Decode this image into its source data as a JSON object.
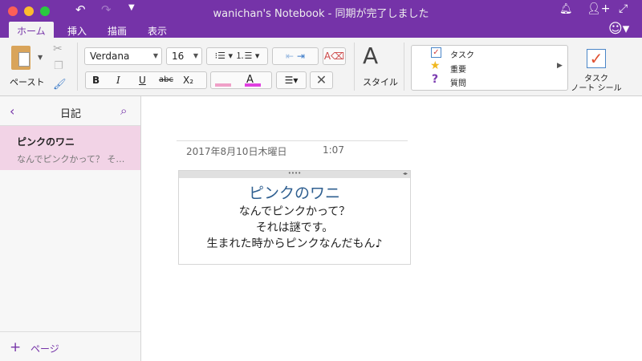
{
  "window": {
    "title": "wanichan's Notebook - 同期が完了しました"
  },
  "tabs": [
    "ホーム",
    "挿入",
    "描画",
    "表示"
  ],
  "ribbon": {
    "paste": "ペースト",
    "font": "Verdana",
    "size": "16",
    "bold": "B",
    "italic": "I",
    "underline": "U",
    "strike": "abc",
    "subscript": "X₂",
    "font_color": "A",
    "style": "スタイル",
    "tags": [
      {
        "label": "タスク",
        "icon": "checkbox-icon"
      },
      {
        "label": "重要",
        "icon": "star-icon"
      },
      {
        "label": "質問",
        "icon": "question-icon"
      }
    ],
    "task_note_tag": [
      "タスク",
      "ノート シール"
    ]
  },
  "colors": {
    "accent": "#7533a8",
    "highlight": "#f0a0c8",
    "font_color": "#e040e0",
    "selected_page": "#f2d3e6"
  },
  "sidebar": {
    "section": "日記",
    "pages": [
      {
        "title": "ピンクのワニ",
        "preview": "なんでピンクかって？ そ…"
      }
    ],
    "add_page": "ページ"
  },
  "page": {
    "date": "2017年8月10日木曜日",
    "time": "1:07",
    "lines": [
      "ピンクのワニ",
      "なんでピンクかって？",
      "それは謎です。",
      "生まれた時からピンクなんだもん♪"
    ]
  }
}
